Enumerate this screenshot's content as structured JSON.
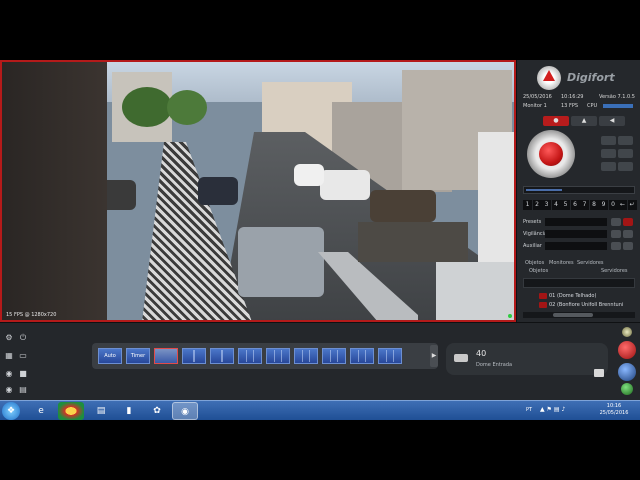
{
  "video": {
    "overlay": "15 FPS @ 1280x720"
  },
  "panel": {
    "brand": "Digifort",
    "date": "25/05/2016",
    "time": "10:16:29",
    "version": "Versão 7.1.0.5",
    "monitor": "Monitor 1",
    "fps": "13 FPS",
    "cpu": "CPU",
    "numbers": [
      "1",
      "2",
      "3",
      "4",
      "5",
      "6",
      "7",
      "8",
      "9",
      "0",
      "←",
      "↵"
    ],
    "presets_label": "Presets",
    "vigilancia_label": "Vigilância",
    "auxiliar_label": "Auxiliar",
    "tabs": [
      "Objetos",
      "Monitores",
      "Servidores"
    ],
    "subtabs": [
      "Objetos",
      "Servidores"
    ],
    "tree_items": [
      "01 (Dome Telhado)",
      "02 (Bonfiore Unifoll Brenntuni"
    ]
  },
  "bottom": {
    "layouts": [
      "Auto",
      "Timer",
      "",
      "",
      "",
      "",
      "",
      "",
      "",
      "",
      ""
    ],
    "camera_number": "40",
    "camera_name": "Dome Entrada"
  },
  "taskbar": {
    "language": "PT",
    "clock_time": "10:16",
    "clock_date": "25/05/2016"
  },
  "colors": {
    "accent": "#b41a1a",
    "layout_blue": "#4b77c9",
    "taskbar": "#1f4f95"
  }
}
